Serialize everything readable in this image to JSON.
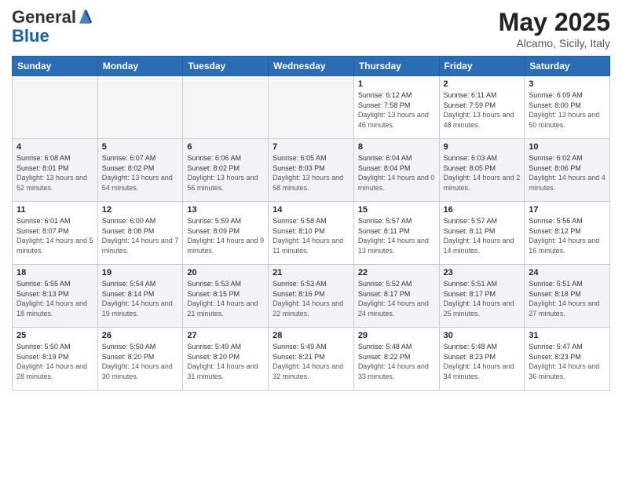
{
  "header": {
    "logo_general": "General",
    "logo_blue": "Blue",
    "month": "May 2025",
    "location": "Alcamo, Sicily, Italy"
  },
  "weekdays": [
    "Sunday",
    "Monday",
    "Tuesday",
    "Wednesday",
    "Thursday",
    "Friday",
    "Saturday"
  ],
  "weeks": [
    [
      {
        "day": "",
        "sunrise": "",
        "sunset": "",
        "daylight": ""
      },
      {
        "day": "",
        "sunrise": "",
        "sunset": "",
        "daylight": ""
      },
      {
        "day": "",
        "sunrise": "",
        "sunset": "",
        "daylight": ""
      },
      {
        "day": "",
        "sunrise": "",
        "sunset": "",
        "daylight": ""
      },
      {
        "day": "1",
        "sunrise": "Sunrise: 6:12 AM",
        "sunset": "Sunset: 7:58 PM",
        "daylight": "Daylight: 13 hours and 46 minutes."
      },
      {
        "day": "2",
        "sunrise": "Sunrise: 6:11 AM",
        "sunset": "Sunset: 7:59 PM",
        "daylight": "Daylight: 13 hours and 48 minutes."
      },
      {
        "day": "3",
        "sunrise": "Sunrise: 6:09 AM",
        "sunset": "Sunset: 8:00 PM",
        "daylight": "Daylight: 13 hours and 50 minutes."
      }
    ],
    [
      {
        "day": "4",
        "sunrise": "Sunrise: 6:08 AM",
        "sunset": "Sunset: 8:01 PM",
        "daylight": "Daylight: 13 hours and 52 minutes."
      },
      {
        "day": "5",
        "sunrise": "Sunrise: 6:07 AM",
        "sunset": "Sunset: 8:02 PM",
        "daylight": "Daylight: 13 hours and 54 minutes."
      },
      {
        "day": "6",
        "sunrise": "Sunrise: 6:06 AM",
        "sunset": "Sunset: 8:02 PM",
        "daylight": "Daylight: 13 hours and 56 minutes."
      },
      {
        "day": "7",
        "sunrise": "Sunrise: 6:05 AM",
        "sunset": "Sunset: 8:03 PM",
        "daylight": "Daylight: 13 hours and 58 minutes."
      },
      {
        "day": "8",
        "sunrise": "Sunrise: 6:04 AM",
        "sunset": "Sunset: 8:04 PM",
        "daylight": "Daylight: 14 hours and 0 minutes."
      },
      {
        "day": "9",
        "sunrise": "Sunrise: 6:03 AM",
        "sunset": "Sunset: 8:05 PM",
        "daylight": "Daylight: 14 hours and 2 minutes."
      },
      {
        "day": "10",
        "sunrise": "Sunrise: 6:02 AM",
        "sunset": "Sunset: 8:06 PM",
        "daylight": "Daylight: 14 hours and 4 minutes."
      }
    ],
    [
      {
        "day": "11",
        "sunrise": "Sunrise: 6:01 AM",
        "sunset": "Sunset: 8:07 PM",
        "daylight": "Daylight: 14 hours and 5 minutes."
      },
      {
        "day": "12",
        "sunrise": "Sunrise: 6:00 AM",
        "sunset": "Sunset: 8:08 PM",
        "daylight": "Daylight: 14 hours and 7 minutes."
      },
      {
        "day": "13",
        "sunrise": "Sunrise: 5:59 AM",
        "sunset": "Sunset: 8:09 PM",
        "daylight": "Daylight: 14 hours and 9 minutes."
      },
      {
        "day": "14",
        "sunrise": "Sunrise: 5:58 AM",
        "sunset": "Sunset: 8:10 PM",
        "daylight": "Daylight: 14 hours and 11 minutes."
      },
      {
        "day": "15",
        "sunrise": "Sunrise: 5:57 AM",
        "sunset": "Sunset: 8:11 PM",
        "daylight": "Daylight: 14 hours and 13 minutes."
      },
      {
        "day": "16",
        "sunrise": "Sunrise: 5:57 AM",
        "sunset": "Sunset: 8:11 PM",
        "daylight": "Daylight: 14 hours and 14 minutes."
      },
      {
        "day": "17",
        "sunrise": "Sunrise: 5:56 AM",
        "sunset": "Sunset: 8:12 PM",
        "daylight": "Daylight: 14 hours and 16 minutes."
      }
    ],
    [
      {
        "day": "18",
        "sunrise": "Sunrise: 5:55 AM",
        "sunset": "Sunset: 8:13 PM",
        "daylight": "Daylight: 14 hours and 18 minutes."
      },
      {
        "day": "19",
        "sunrise": "Sunrise: 5:54 AM",
        "sunset": "Sunset: 8:14 PM",
        "daylight": "Daylight: 14 hours and 19 minutes."
      },
      {
        "day": "20",
        "sunrise": "Sunrise: 5:53 AM",
        "sunset": "Sunset: 8:15 PM",
        "daylight": "Daylight: 14 hours and 21 minutes."
      },
      {
        "day": "21",
        "sunrise": "Sunrise: 5:53 AM",
        "sunset": "Sunset: 8:16 PM",
        "daylight": "Daylight: 14 hours and 22 minutes."
      },
      {
        "day": "22",
        "sunrise": "Sunrise: 5:52 AM",
        "sunset": "Sunset: 8:17 PM",
        "daylight": "Daylight: 14 hours and 24 minutes."
      },
      {
        "day": "23",
        "sunrise": "Sunrise: 5:51 AM",
        "sunset": "Sunset: 8:17 PM",
        "daylight": "Daylight: 14 hours and 25 minutes."
      },
      {
        "day": "24",
        "sunrise": "Sunrise: 5:51 AM",
        "sunset": "Sunset: 8:18 PM",
        "daylight": "Daylight: 14 hours and 27 minutes."
      }
    ],
    [
      {
        "day": "25",
        "sunrise": "Sunrise: 5:50 AM",
        "sunset": "Sunset: 8:19 PM",
        "daylight": "Daylight: 14 hours and 28 minutes."
      },
      {
        "day": "26",
        "sunrise": "Sunrise: 5:50 AM",
        "sunset": "Sunset: 8:20 PM",
        "daylight": "Daylight: 14 hours and 30 minutes."
      },
      {
        "day": "27",
        "sunrise": "Sunrise: 5:49 AM",
        "sunset": "Sunset: 8:20 PM",
        "daylight": "Daylight: 14 hours and 31 minutes."
      },
      {
        "day": "28",
        "sunrise": "Sunrise: 5:49 AM",
        "sunset": "Sunset: 8:21 PM",
        "daylight": "Daylight: 14 hours and 32 minutes."
      },
      {
        "day": "29",
        "sunrise": "Sunrise: 5:48 AM",
        "sunset": "Sunset: 8:22 PM",
        "daylight": "Daylight: 14 hours and 33 minutes."
      },
      {
        "day": "30",
        "sunrise": "Sunrise: 5:48 AM",
        "sunset": "Sunset: 8:23 PM",
        "daylight": "Daylight: 14 hours and 34 minutes."
      },
      {
        "day": "31",
        "sunrise": "Sunrise: 5:47 AM",
        "sunset": "Sunset: 8:23 PM",
        "daylight": "Daylight: 14 hours and 36 minutes."
      }
    ]
  ]
}
